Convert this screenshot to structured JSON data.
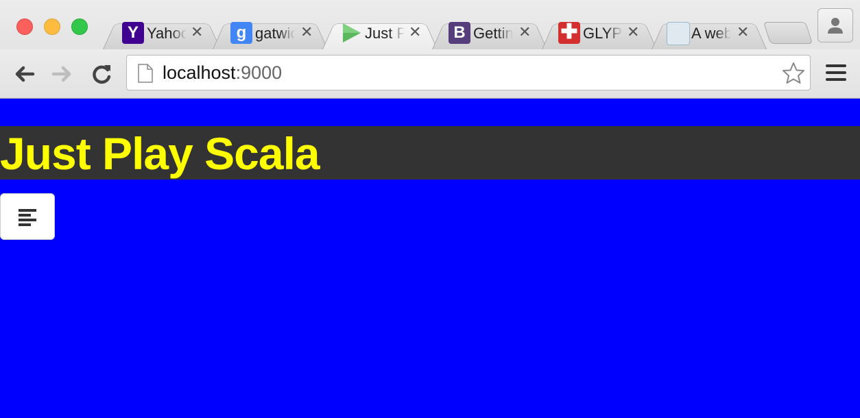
{
  "browser": {
    "tabs": [
      {
        "title": "Yahoo",
        "favicon": "yahoo-icon",
        "color": "#400090"
      },
      {
        "title": "gatwick",
        "favicon": "google-icon",
        "color": "#4285f4"
      },
      {
        "title": "Just Play Scala",
        "favicon": "play-icon",
        "color": "#5cb85c"
      },
      {
        "title": "Getting started",
        "favicon": "bootstrap-icon",
        "color": "#563d7c"
      },
      {
        "title": "GLYPHICONS",
        "favicon": "glyphicons-icon",
        "color": "#d32f2f"
      },
      {
        "title": "A web",
        "favicon": "web-icon",
        "color": "#8ab"
      }
    ],
    "url_host": "localhost",
    "url_port": ":9000"
  },
  "page": {
    "title": "Just Play Scala",
    "background": "#0000ff",
    "header_background": "#333333",
    "title_color": "#ffff00"
  },
  "icons": {
    "toggle": "align-left-icon"
  }
}
